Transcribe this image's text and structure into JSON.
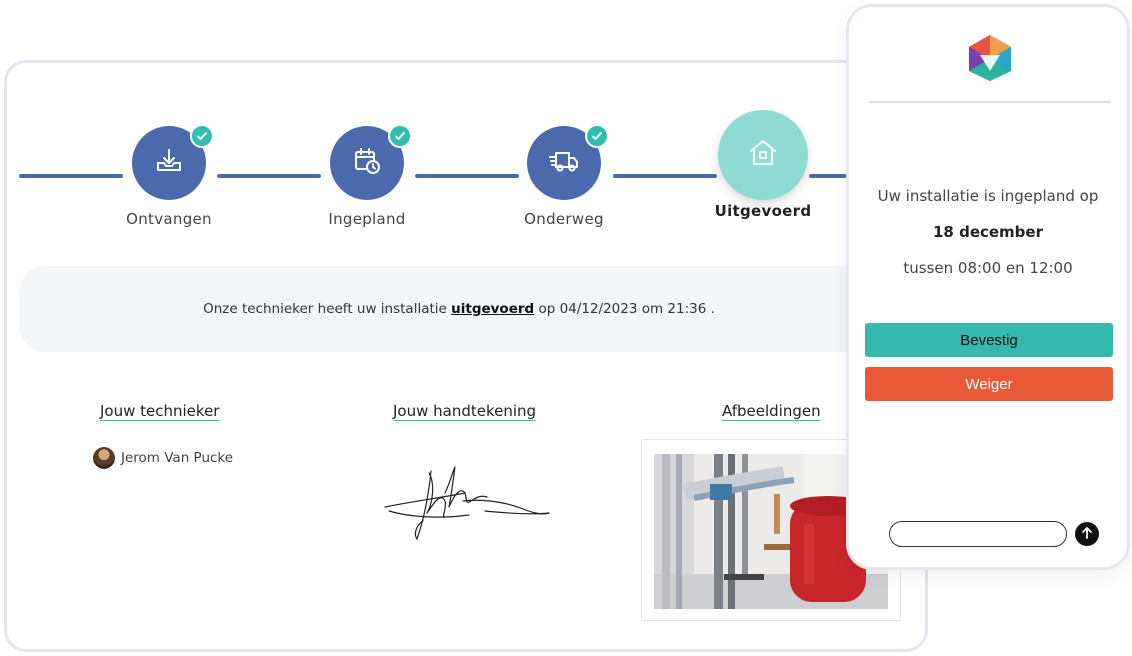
{
  "steps": [
    {
      "label": "Ontvangen",
      "icon": "download-tray-icon",
      "completed": true
    },
    {
      "label": "Ingepland",
      "icon": "calendar-clock-icon",
      "completed": true
    },
    {
      "label": "Onderweg",
      "icon": "delivery-truck-icon",
      "completed": true
    },
    {
      "label": "Uitgevoerd",
      "icon": "house-icon",
      "current": true
    }
  ],
  "status": {
    "prefix": "Onze technieker heeft uw installatie ",
    "link": "uitgevoerd",
    "suffix": " op 04/12/2023 om 21:36 ."
  },
  "sections": {
    "technician_title": "Jouw technieker",
    "technician_name": "Jerom Van Pucke",
    "signature_title": "Jouw handtekening",
    "images_title": "Afbeeldingen"
  },
  "phone": {
    "message": "Uw installatie is ingepland op",
    "date": "18 december",
    "time": "tussen 08:00 en 12:00",
    "confirm_label": "Bevestig",
    "decline_label": "Weiger"
  },
  "colors": {
    "primary": "#4b6aad",
    "accent": "#2fbfae",
    "current_step": "#8fdad2",
    "confirm": "#35b8ad",
    "decline": "#e85a38"
  }
}
